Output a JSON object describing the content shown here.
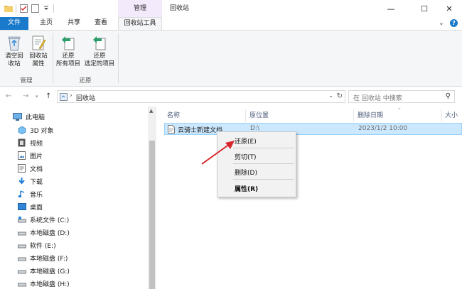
{
  "titlebar": {
    "context_tab": "管理",
    "window_title": "回收站",
    "minimize_glyph": "—",
    "maximize_glyph": "☐",
    "close_glyph": "✕"
  },
  "tabs": {
    "file": "文件",
    "home": "主页",
    "share": "共享",
    "view": "查看",
    "recycle_tools": "回收站工具",
    "collapse_glyph": "⌄",
    "help_glyph": "?"
  },
  "ribbon": {
    "empty_recycle_bin": [
      "清空回",
      "收站"
    ],
    "recycle_bin_properties": [
      "回收站",
      "属性"
    ],
    "group_manage": "管理",
    "restore_all": [
      "还原",
      "所有项目"
    ],
    "restore_selected": [
      "还原",
      "选定的项目"
    ],
    "group_restore": "还原"
  },
  "address": {
    "path_label": "回收站",
    "search_placeholder": "在 回收站 中搜索"
  },
  "navpane": {
    "items": [
      {
        "label": "此电脑",
        "icon": "computer-icon"
      },
      {
        "label": "3D 对象",
        "icon": "3d-objects-icon"
      },
      {
        "label": "视频",
        "icon": "video-icon"
      },
      {
        "label": "图片",
        "icon": "pictures-icon"
      },
      {
        "label": "文档",
        "icon": "documents-icon"
      },
      {
        "label": "下载",
        "icon": "download-icon"
      },
      {
        "label": "音乐",
        "icon": "music-icon"
      },
      {
        "label": "桌面",
        "icon": "desktop-icon"
      },
      {
        "label": "系统文件 (C:)",
        "icon": "drive-icon"
      },
      {
        "label": "本地磁盘 (D:)",
        "icon": "drive-icon"
      },
      {
        "label": "软件 (E:)",
        "icon": "drive-icon"
      },
      {
        "label": "本地磁盘 (F:)",
        "icon": "drive-icon"
      },
      {
        "label": "本地磁盘 (G:)",
        "icon": "drive-icon"
      },
      {
        "label": "本地磁盘 (H:)",
        "icon": "drive-icon"
      }
    ]
  },
  "columns": {
    "name": "名称",
    "original_location": "原位置",
    "date_deleted": "删除日期",
    "size": "大小"
  },
  "files": [
    {
      "name": "云骑士新建文档",
      "location": "D:\\",
      "date_deleted": "2023/1/2 10:00"
    }
  ],
  "context_menu": {
    "restore": "还原(E)",
    "cut": "剪切(T)",
    "delete": "删除(D)",
    "properties": "属性(R)"
  },
  "colors": {
    "accent": "#1979ca",
    "selection": "#cce8ff",
    "annotation_arrow": "#d9262b"
  }
}
